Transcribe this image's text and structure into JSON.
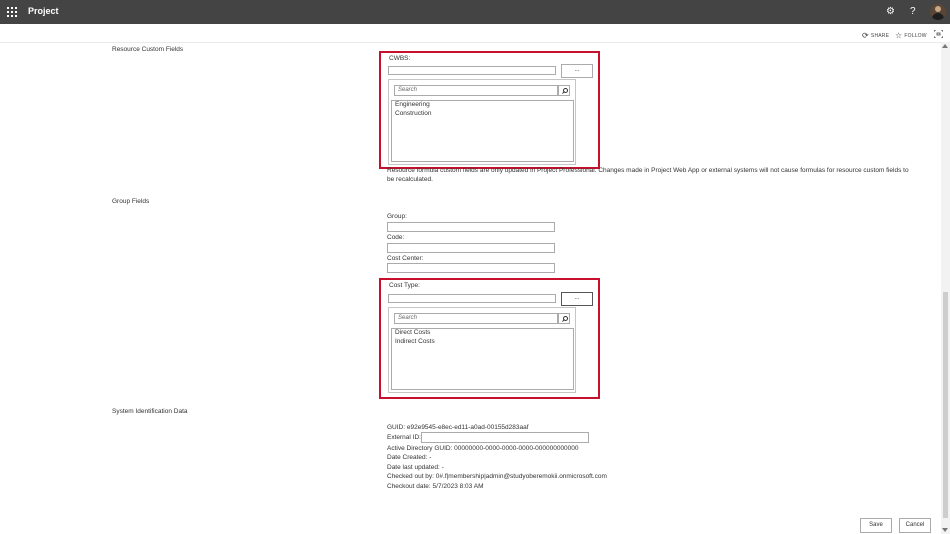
{
  "header": {
    "app_title": "Project",
    "settings_glyph": "⚙",
    "help_glyph": "?"
  },
  "actions": {
    "share": "SHARE",
    "follow": "FOLLOW"
  },
  "resource_custom_fields": {
    "section_label": "Resource Custom Fields",
    "cwbs": {
      "label": "CWBS:",
      "value": "",
      "browse_label": "...",
      "search_placeholder": "Search",
      "options": [
        "Engineering",
        "Construction"
      ]
    },
    "note": "Resource formula custom fields are only updated in Project Professional. Changes made in Project Web App or external systems will not cause formulas for resource custom fields to be recalculated."
  },
  "group_fields": {
    "section_label": "Group Fields",
    "group_label": "Group:",
    "code_label": "Code:",
    "cost_center_label": "Cost Center:",
    "cost_type": {
      "label": "Cost Type:",
      "value": "",
      "browse_label": "...",
      "search_placeholder": "Search",
      "options": [
        "Direct Costs",
        "Indirect Costs"
      ]
    }
  },
  "system_identification": {
    "section_label": "System Identification Data",
    "guid": "GUID: e92e9545-e8ec-ed11-a0ad-00155d283aaf",
    "external_id_label": "External ID:",
    "active_directory_guid": "Active Directory GUID: 00000000-0000-0000-0000-000000000000",
    "date_created": "Date Created: -",
    "date_last_updated": "Date last updated: -",
    "checked_out_by": "Checked out by: 0#.f|membership|admin@studyoberemokii.onmicrosoft.com",
    "checkout_date": "Checkout date: 5/7/2023 8:03 AM"
  },
  "footer": {
    "save": "Save",
    "cancel": "Cancel"
  },
  "colors": {
    "topbar": "#444444",
    "highlight": "#c8102e"
  }
}
